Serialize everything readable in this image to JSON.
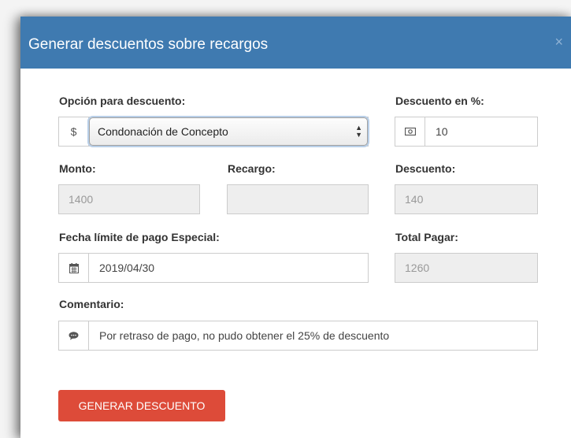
{
  "modal": {
    "title": "Generar descuentos sobre recargos",
    "close_icon": "×"
  },
  "form": {
    "option": {
      "label": "Opción para descuento:",
      "addon": "$",
      "selected": "Condonación de Concepto"
    },
    "discount_percent": {
      "label": "Descuento en %:",
      "icon": "money-icon",
      "value": "10"
    },
    "monto": {
      "label": "Monto:",
      "value": "1400"
    },
    "recargo": {
      "label": "Recargo:",
      "value": ""
    },
    "descuento": {
      "label": "Descuento:",
      "value": "140"
    },
    "fecha": {
      "label": "Fecha límite de pago Especial:",
      "icon": "calendar-icon",
      "value": "2019/04/30"
    },
    "total": {
      "label": "Total Pagar:",
      "value": "1260"
    },
    "comentario": {
      "label": "Comentario:",
      "icon": "comment-icon",
      "value": "Por retraso de pago, no pudo obtener el 25% de descuento"
    },
    "submit_label": "GENERAR DESCUENTO"
  },
  "colors": {
    "header": "#3f7ab0",
    "button": "#dd4b39"
  }
}
